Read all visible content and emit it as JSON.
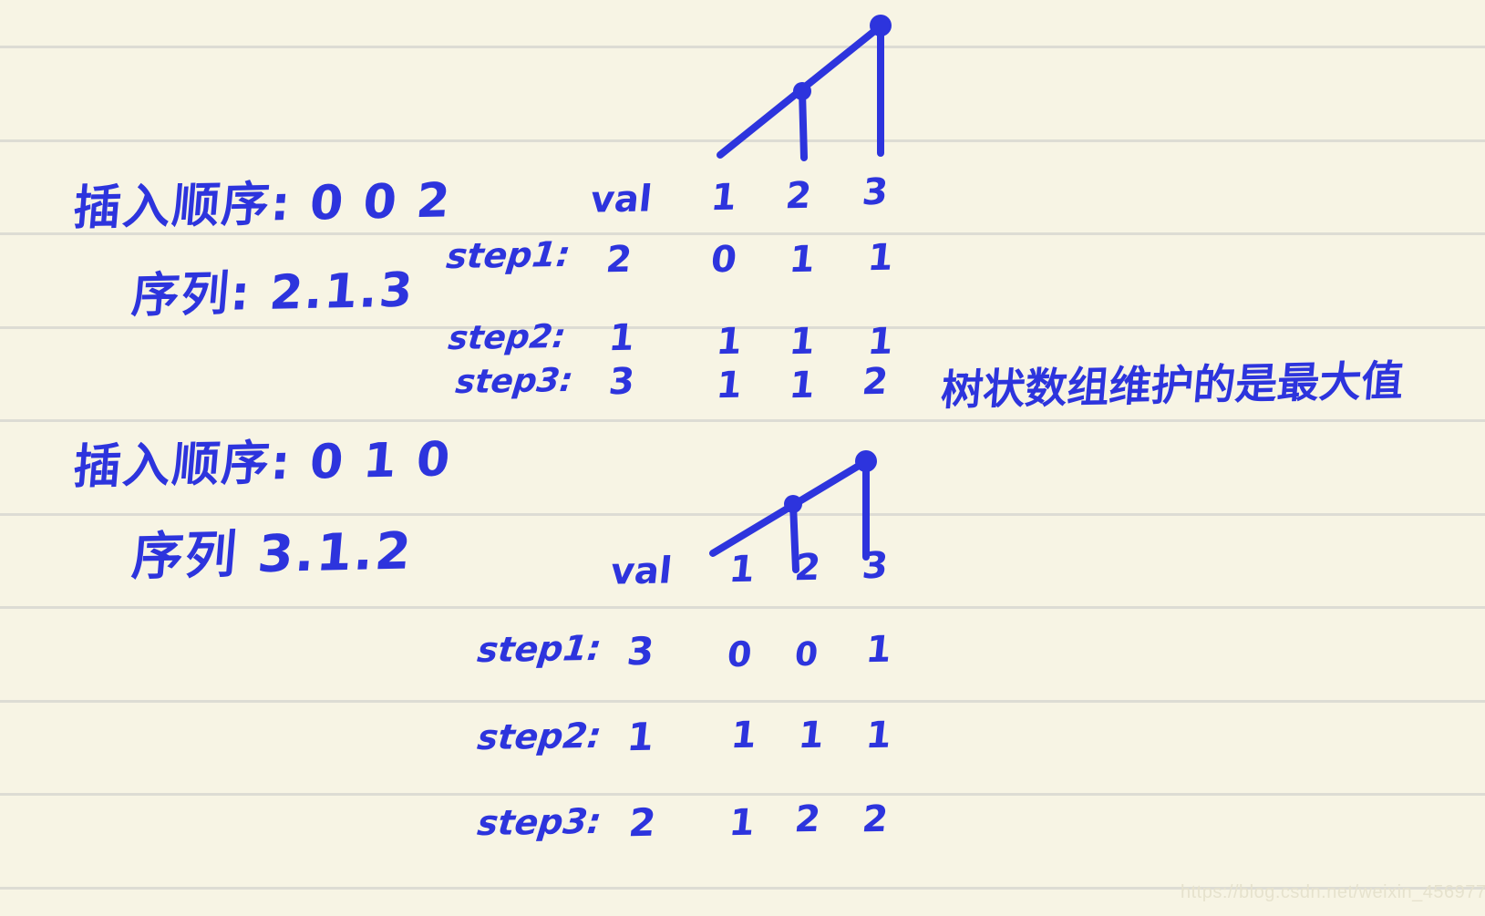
{
  "page": {
    "background_color": "#f7f4e4",
    "rule_color": "#dddcd4",
    "ink_color": "#2d34dd",
    "watermark": "https://blog.csdn.net/weixin_45697774"
  },
  "note": {
    "annotation": "树状数组维护的是最大值",
    "blocks": [
      {
        "insert_order_label": "插入顺序: 0 0 2",
        "sequence_label": "序列: 2.1.3",
        "table": {
          "headers": [
            "val",
            "1",
            "2",
            "3"
          ],
          "rows": [
            {
              "label": "step1:",
              "val": "2",
              "cells": [
                "0",
                "1",
                "1"
              ]
            },
            {
              "label": "step2:",
              "val": "1",
              "cells": [
                "1",
                "1",
                "1"
              ]
            },
            {
              "label": "step3:",
              "val": "3",
              "cells": [
                "1",
                "1",
                "2"
              ]
            }
          ]
        }
      },
      {
        "insert_order_label": "插入顺序: 0 1 0",
        "sequence_label": "序列 3.1.2",
        "table": {
          "headers": [
            "val",
            "1",
            "2",
            "3"
          ],
          "rows": [
            {
              "label": "step1:",
              "val": "3",
              "cells": [
                "0",
                "0",
                "1"
              ]
            },
            {
              "label": "step2:",
              "val": "1",
              "cells": [
                "1",
                "1",
                "1"
              ]
            },
            {
              "label": "step3:",
              "val": "2",
              "cells": [
                "1",
                "2",
                "2"
              ]
            }
          ]
        }
      }
    ]
  }
}
